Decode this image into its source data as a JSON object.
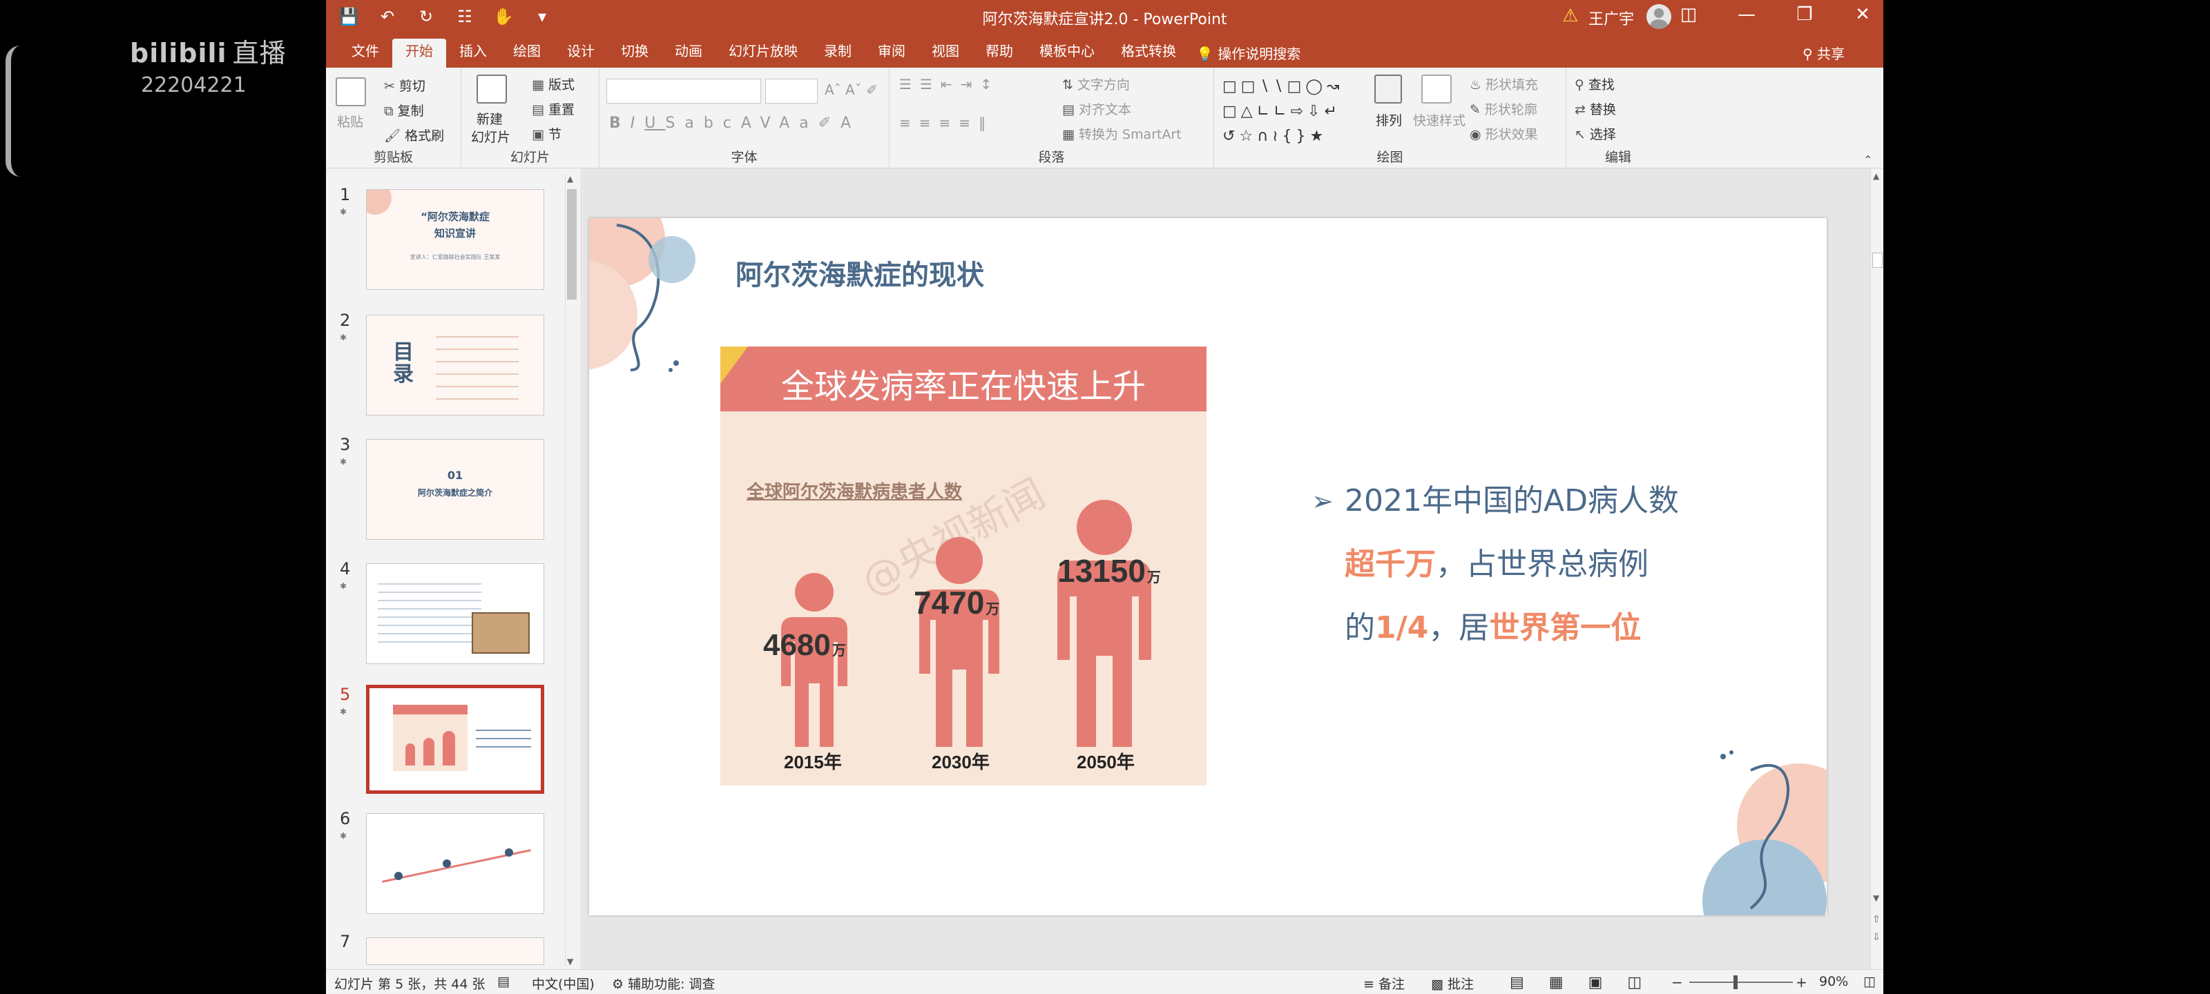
{
  "stream": {
    "logo": "bilibili",
    "live": "直播",
    "room_id": "22204221"
  },
  "titlebar": {
    "title": "阿尔茨海默症宣讲2.0 - PowerPoint",
    "user": "王广宇",
    "qat_icons": [
      "save-icon",
      "undo-icon",
      "redo-icon",
      "format-painter-icon",
      "touch-mode-icon",
      "customize-icon"
    ]
  },
  "tabs": [
    "文件",
    "开始",
    "插入",
    "绘图",
    "设计",
    "切换",
    "动画",
    "幻灯片放映",
    "录制",
    "审阅",
    "视图",
    "帮助",
    "模板中心",
    "格式转换"
  ],
  "active_tab": "开始",
  "tell_me": "操作说明搜索",
  "share": "共享",
  "ribbon": {
    "clipboard": {
      "label": "剪贴板",
      "paste": "粘贴",
      "cut": "剪切",
      "copy": "复制",
      "format_painter": "格式刷"
    },
    "slides": {
      "label": "幻灯片",
      "new_slide": "新建",
      "new_slide2": "幻灯片",
      "layout": "版式",
      "reset": "重置",
      "section": "节"
    },
    "font": {
      "label": "字体"
    },
    "paragraph": {
      "label": "段落",
      "text_direction": "文字方向",
      "align_text": "对齐文本",
      "smartart": "转换为 SmartArt"
    },
    "drawing": {
      "label": "绘图",
      "arrange": "排列",
      "quick_styles": "快速样式",
      "shape_fill": "形状填充",
      "shape_outline": "形状轮廓",
      "shape_effects": "形状效果"
    },
    "editing": {
      "label": "编辑",
      "find": "查找",
      "replace": "替换",
      "select": "选择"
    }
  },
  "thumbnails": [
    {
      "num": "1",
      "title": "“阿尔茨海默症",
      "title2": "知识宣讲",
      "sub": "宣讲人：仁爱路联社会实践队 王某某"
    },
    {
      "num": "2",
      "title": "目录"
    },
    {
      "num": "3",
      "title": "01",
      "sub": "阿尔茨海默症之简介"
    },
    {
      "num": "4"
    },
    {
      "num": "5"
    },
    {
      "num": "6"
    },
    {
      "num": "7"
    }
  ],
  "selected_slide": "5",
  "slide": {
    "title": "阿尔茨海默症的现状",
    "poster": {
      "heading": "全球发病率正在快速上升",
      "subtitle": "全球阿尔茨海默病患者人数",
      "watermark": "@央视新闻",
      "unit": "万",
      "people": [
        {
          "year": "2015年",
          "value": 4680,
          "label": "4680"
        },
        {
          "year": "2030年",
          "value": 7470,
          "label": "7470"
        },
        {
          "year": "2050年",
          "value": 13150,
          "label": "13150"
        }
      ]
    },
    "bullet": {
      "line1": "2021年中国的AD病人数",
      "hl1": "超千万",
      "line2": "，占世界总病例",
      "pre3": "的",
      "hl2": "1/4",
      "mid3": "，居",
      "hl3": "世界第一位"
    }
  },
  "statusbar": {
    "slide_info": "幻灯片 第 5 张，共 44 张",
    "language": "中文(中国)",
    "accessibility": "辅助功能: 调查",
    "notes": "备注",
    "comments": "批注",
    "zoom": "90%"
  },
  "colors": {
    "brand": "#b7472a",
    "accent": "#e57c74",
    "title_blue": "#4b6a8a",
    "highlight": "#f08a66"
  }
}
